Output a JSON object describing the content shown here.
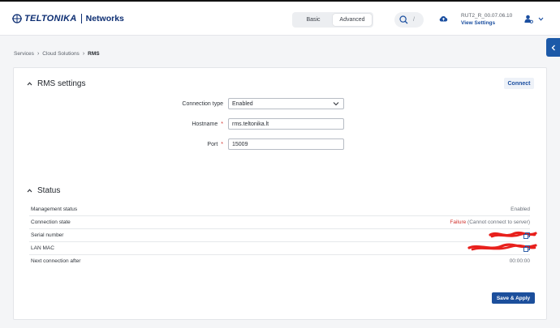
{
  "app": {
    "brand": "TELTONIKA",
    "product": "Networks"
  },
  "header": {
    "modes": [
      {
        "label": "Basic",
        "active": false
      },
      {
        "label": "Advanced",
        "active": true
      }
    ],
    "search_shortcut": "/",
    "device_name": "RUT2_R_00.07.06.10",
    "view_settings": "View Settings"
  },
  "breadcrumb": {
    "items": [
      "Services",
      "Cloud Solutions"
    ],
    "current": "RMS"
  },
  "rms_settings": {
    "title": "RMS settings",
    "connect_label": "Connect",
    "fields": {
      "connection_type": {
        "label": "Connection type",
        "value": "Enabled"
      },
      "hostname": {
        "label": "Hostname",
        "required": "*",
        "value": "rms.teltonika.lt"
      },
      "port": {
        "label": "Port",
        "required": "*",
        "value": "15009"
      }
    }
  },
  "status": {
    "title": "Status",
    "rows": [
      {
        "key": "Management status",
        "value": "Enabled"
      },
      {
        "key": "Connection state",
        "value_error": "Failure",
        "value_detail": "(Cannot connect to server)"
      },
      {
        "key": "Serial number"
      },
      {
        "key": "LAN MAC"
      },
      {
        "key": "Next connection after",
        "value": "00:00:00"
      }
    ]
  },
  "actions": {
    "save_label": "Save & Apply"
  },
  "colors": {
    "brand": "#0e2f73",
    "primary": "#1c4f9c",
    "error": "#d0302b",
    "redaction": "#e8201c"
  }
}
